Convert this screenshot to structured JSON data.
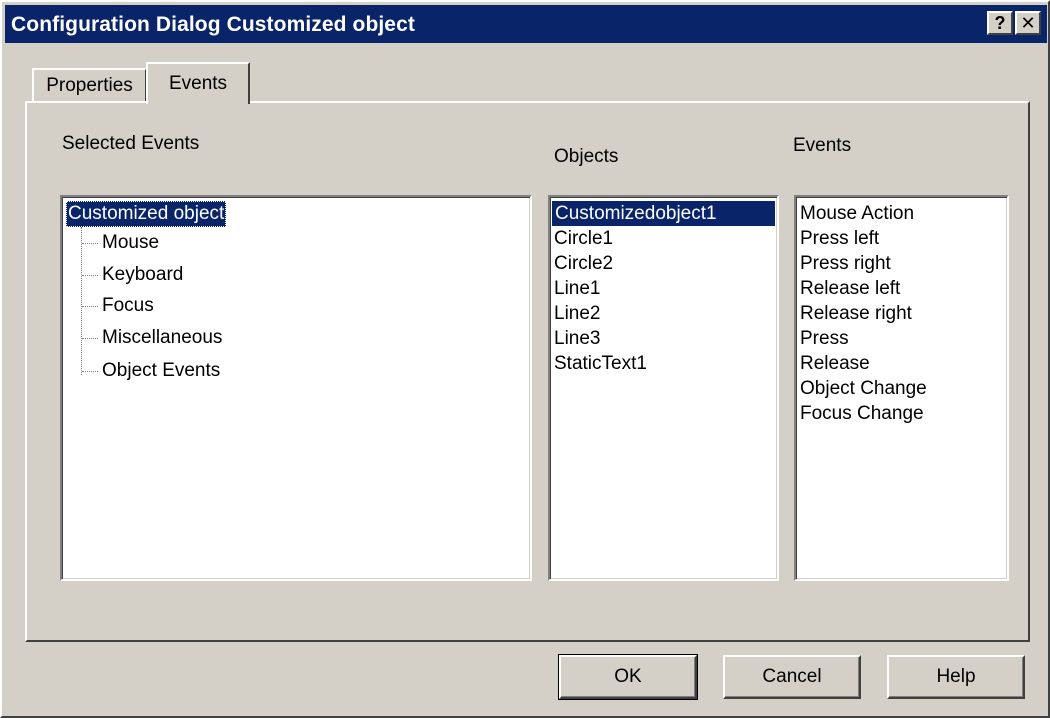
{
  "window": {
    "title": "Configuration Dialog Customized object",
    "help_button": "?",
    "close_button": "✕"
  },
  "tabs": [
    {
      "label": "Properties",
      "active": false
    },
    {
      "label": "Events",
      "active": true
    }
  ],
  "selected_events": {
    "label": "Selected Events",
    "tree": {
      "root": "Customized object",
      "children": [
        "Mouse",
        "Keyboard",
        "Focus",
        "Miscellaneous",
        "Object Events"
      ]
    }
  },
  "objects": {
    "label": "Objects",
    "items": [
      "Customizedobject1",
      "Circle1",
      "Circle2",
      "Line1",
      "Line2",
      "Line3",
      "StaticText1"
    ],
    "selected": "Customizedobject1"
  },
  "events": {
    "label": "Events",
    "items": [
      "Mouse Action",
      "Press left",
      "Press right",
      "Release left",
      "Release right",
      "Press",
      "Release",
      "Object Change",
      "Focus Change"
    ]
  },
  "buttons": {
    "ok": "OK",
    "cancel": "Cancel",
    "help": "Help"
  },
  "colors": {
    "titlebar": "#0a246a",
    "face": "#d4d0c8",
    "selection": "#0a246a"
  }
}
